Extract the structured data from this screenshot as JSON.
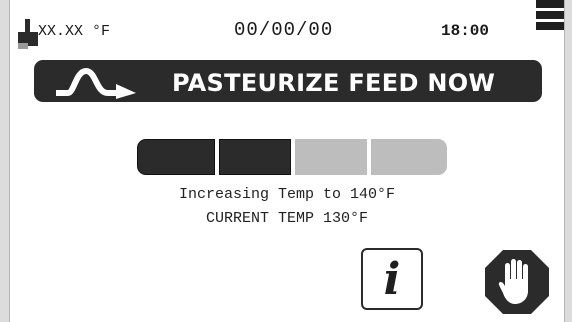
{
  "status_bar": {
    "temperature": "XX.XX °F",
    "date": "00/00/00",
    "time": "18:00",
    "icons": [
      "thermometer-icon",
      "menu-icon"
    ]
  },
  "title_bar": {
    "title": "PASTEURIZE FEED NOW",
    "icon": "pasteurize-curve-arrow-icon"
  },
  "progress": {
    "steps_total": 4,
    "steps_complete": 2
  },
  "messages": {
    "line1": "Increasing Temp to 140°F",
    "line2": "CURRENT TEMP 130°F"
  },
  "buttons": {
    "info_label": "i",
    "info_icon": "info-icon",
    "stop_icon": "stop-hand-icon"
  },
  "colors": {
    "dark": "#2b2b2b",
    "inactive": "#bdbdbd",
    "background": "#ffffff"
  }
}
